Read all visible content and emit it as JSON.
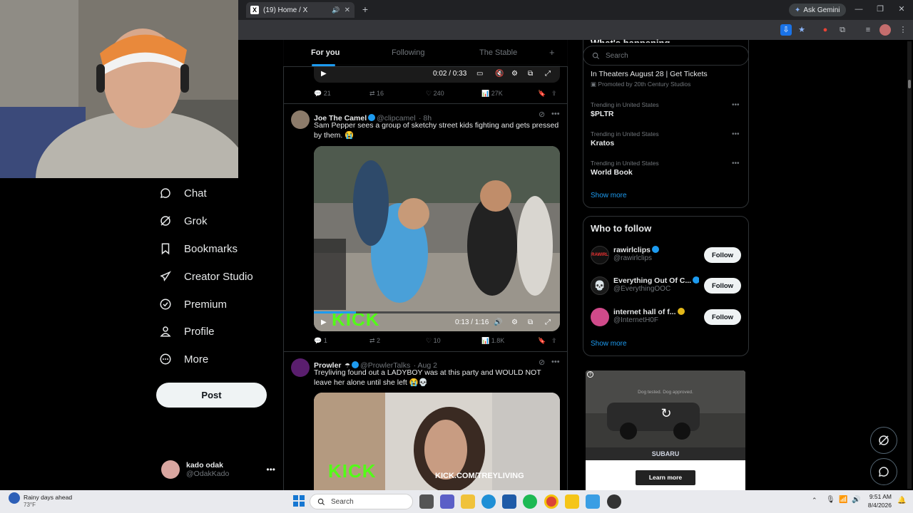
{
  "browser": {
    "tab_title": "(19) Home / X",
    "ask_gemini": "Ask Gemini"
  },
  "nav": {
    "items": [
      {
        "label": "Chat",
        "icon": "chat-icon"
      },
      {
        "label": "Grok",
        "icon": "grok-icon"
      },
      {
        "label": "Bookmarks",
        "icon": "bookmark-icon"
      },
      {
        "label": "Creator Studio",
        "icon": "rocket-icon"
      },
      {
        "label": "Premium",
        "icon": "verified-icon"
      },
      {
        "label": "Profile",
        "icon": "person-icon"
      },
      {
        "label": "More",
        "icon": "more-icon"
      }
    ],
    "post_label": "Post",
    "account": {
      "name": "kado odak",
      "handle": "@OdakKado"
    }
  },
  "home_tabs": {
    "for_you": "For you",
    "following": "Following",
    "the_stable": "The Stable",
    "add": "+"
  },
  "feed": {
    "top_video": {
      "time": "0:02 / 0:33"
    },
    "top_actions": {
      "replies": "21",
      "reposts": "16",
      "likes": "240",
      "views": "27K"
    },
    "tweets": [
      {
        "name": "Joe The Camel",
        "handle": "@clipcamel",
        "time": "· 8h",
        "text": "Sam Pepper sees a group of sketchy street kids fighting and gets pressed by them. 😭",
        "video_time": "0:13 / 1:16",
        "watermark": "KICK",
        "replies": "1",
        "reposts": "2",
        "likes": "10",
        "views": "1.8K"
      },
      {
        "name": "Prowler",
        "handle": "@ProwlerTalks",
        "time": "· Aug 2",
        "text": "Treyliving found out a LADYBOY was at this party and WOULD NOT leave her alone until she left 😭💀",
        "watermark": "KICK",
        "watermark_url": "KICK.COM/TREYLIVING"
      }
    ]
  },
  "right": {
    "search_placeholder": "Search",
    "section_title": "What's happening",
    "promo": {
      "title": "In Theaters August 28 | Get Tickets",
      "promoted": "Promoted by 20th Century Studios"
    },
    "trends": [
      {
        "meta": "Trending in United States",
        "name": "$PLTR"
      },
      {
        "meta": "Trending in United States",
        "name": "Kratos"
      },
      {
        "meta": "Trending in United States",
        "name": "World Book"
      }
    ],
    "show_more": "Show more",
    "who_to_follow": "Who to follow",
    "accounts": [
      {
        "name": "rawirlclips",
        "handle": "@rawirlclips",
        "follow": "Follow"
      },
      {
        "name": "Everything Out Of C...",
        "handle": "@EverythingOOC",
        "follow": "Follow"
      },
      {
        "name": "internet hall of f...",
        "handle": "@InternetH0F",
        "follow": "Follow"
      }
    ],
    "show_more_2": "Show more",
    "ad": {
      "tagline": "Dog tested. Dog approved.",
      "brand": "SUBARU",
      "cta": "Learn more"
    }
  },
  "taskbar": {
    "weather_title": "Rainy days ahead",
    "weather_temp": "73°F",
    "search": "Search",
    "time": "9:51 AM",
    "date": "8/4/2026"
  }
}
